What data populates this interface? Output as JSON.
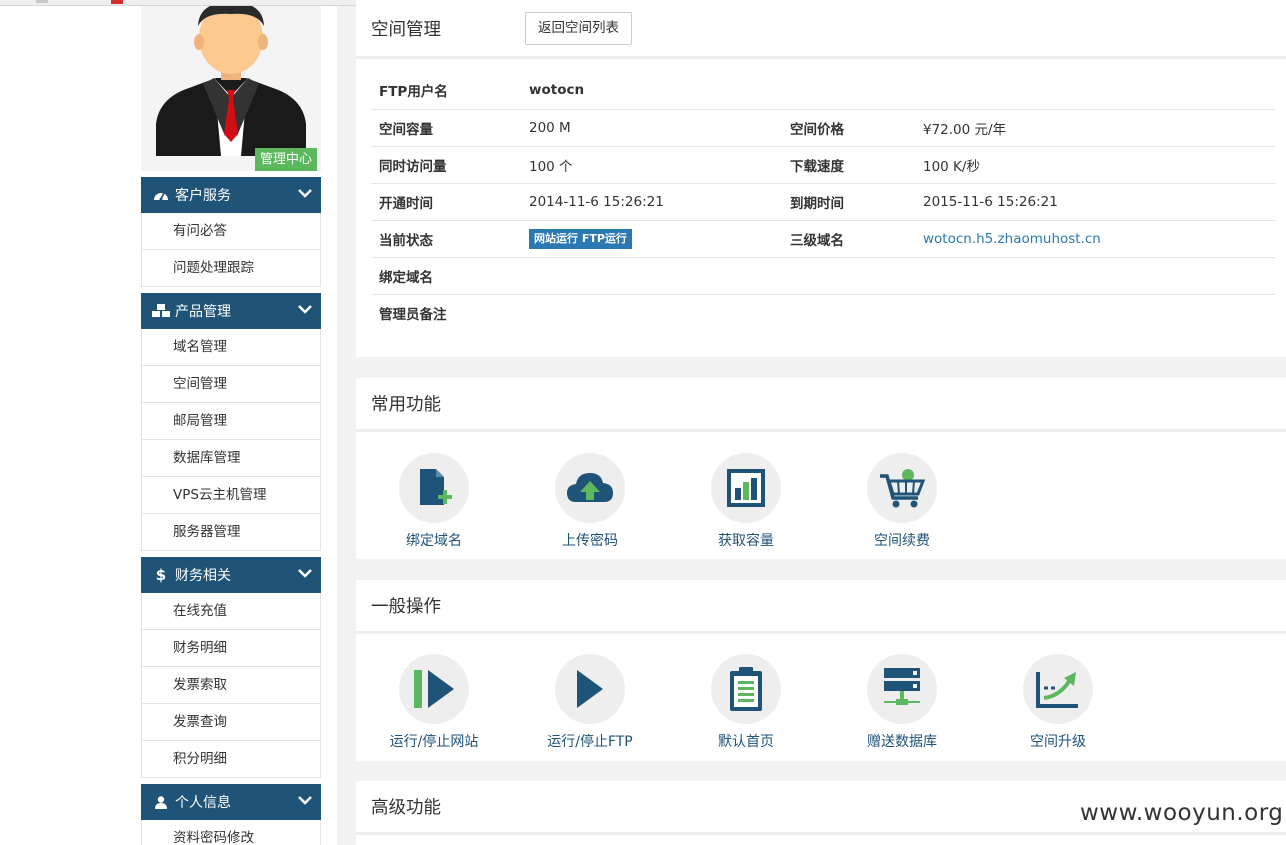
{
  "sidebar": {
    "admin_badge": "管理中心",
    "groups": [
      {
        "title": "客户服务",
        "icon": "dashboard-icon",
        "items": [
          "有问必答",
          "问题处理跟踪"
        ]
      },
      {
        "title": "产品管理",
        "icon": "cubes-icon",
        "items": [
          "域名管理",
          "空间管理",
          "邮局管理",
          "数据库管理",
          "VPS云主机管理",
          "服务器管理"
        ]
      },
      {
        "title": "财务相关",
        "icon": "dollar-icon",
        "items": [
          "在线充值",
          "财务明细",
          "发票索取",
          "发票查询",
          "积分明细"
        ]
      },
      {
        "title": "个人信息",
        "icon": "user-icon",
        "items": [
          "资料密码修改"
        ]
      }
    ]
  },
  "space": {
    "title": "空间管理",
    "back_button": "返回空间列表",
    "ftp_label": "FTP用户名",
    "ftp_value": "wotocn",
    "capacity_label": "空间容量",
    "capacity_value": "200 M",
    "price_label": "空间价格",
    "price_value": "¥72.00 元/年",
    "visits_label": "同时访问量",
    "visits_value": "100 个",
    "speed_label": "下载速度",
    "speed_value": "100 K/秒",
    "open_label": "开通时间",
    "open_value": "2014-11-6 15:26:21",
    "expire_label": "到期时间",
    "expire_value": "2015-11-6 15:26:21",
    "status_label": "当前状态",
    "status_value": "网站运行 FTP运行",
    "subdomain_label": "三级域名",
    "subdomain_value": "wotocn.h5.zhaomuhost.cn",
    "bind_label": "绑定域名",
    "note_label": "管理员备注"
  },
  "common": {
    "title": "常用功能",
    "items": [
      {
        "label": "绑定域名",
        "icon": "file-add-icon"
      },
      {
        "label": "上传密码",
        "icon": "cloud-upload-icon"
      },
      {
        "label": "获取容量",
        "icon": "bar-chart-icon"
      },
      {
        "label": "空间续费",
        "icon": "cart-icon"
      }
    ]
  },
  "general": {
    "title": "一般操作",
    "items": [
      {
        "label": "运行/停止网站",
        "icon": "play-pause-icon"
      },
      {
        "label": "运行/停止FTP",
        "icon": "play-icon"
      },
      {
        "label": "默认首页",
        "icon": "clipboard-icon"
      },
      {
        "label": "赠送数据库",
        "icon": "server-icon"
      },
      {
        "label": "空间升级",
        "icon": "upgrade-chart-icon"
      }
    ]
  },
  "advanced": {
    "title": "高级功能"
  },
  "watermark": "www.wooyun.org",
  "colors": {
    "nav": "#1f5378",
    "green": "#5cb85c",
    "accent": "#2a79b2"
  }
}
